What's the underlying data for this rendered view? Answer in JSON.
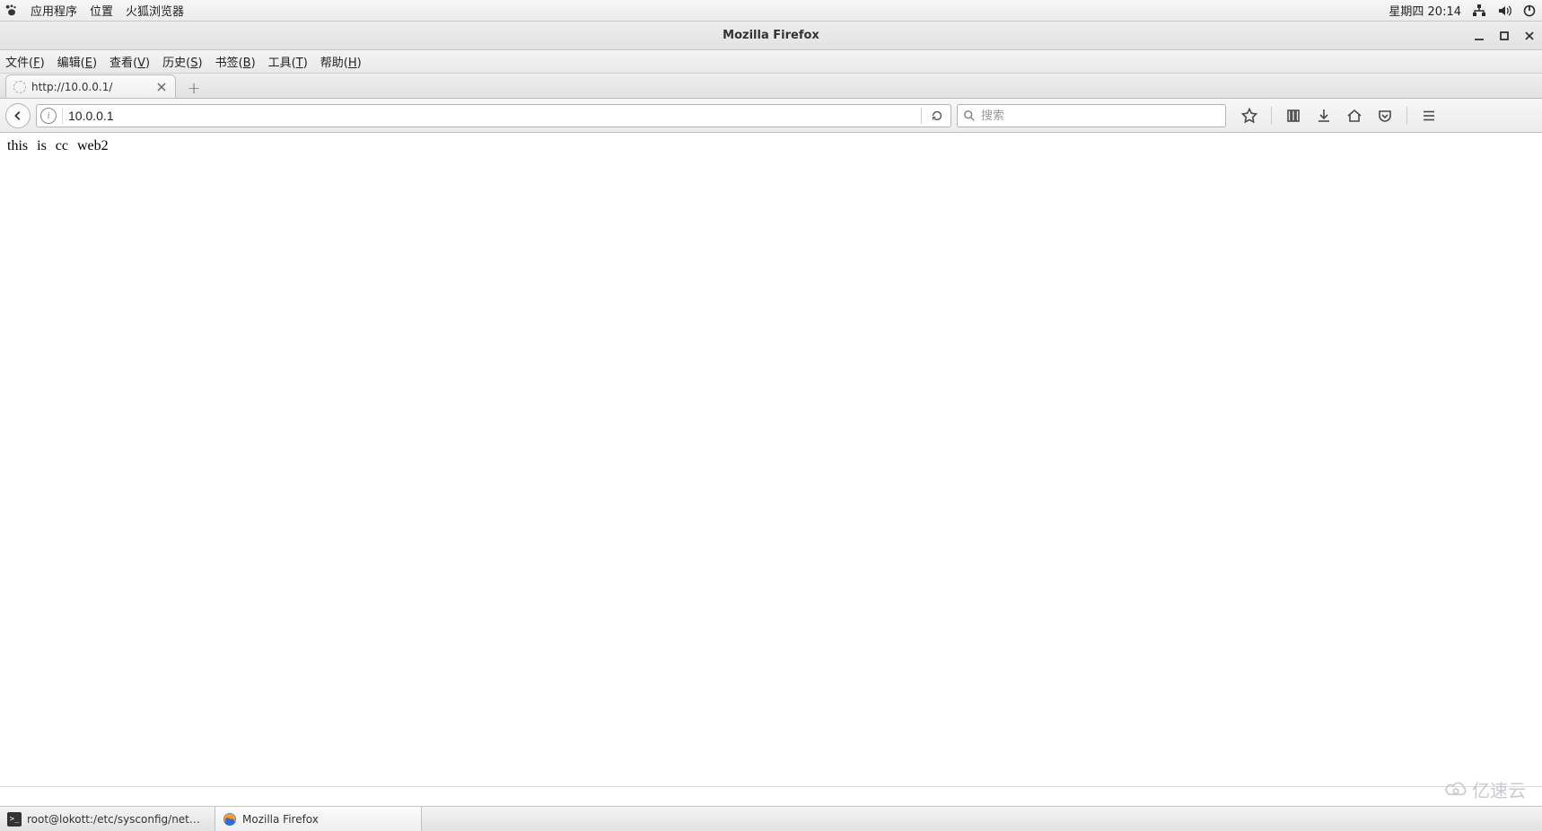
{
  "gnome": {
    "menus": {
      "applications": "应用程序",
      "places": "位置",
      "firefox": "火狐浏览器"
    },
    "clock": "星期四 20:14",
    "tray": {
      "network": "network-icon",
      "volume": "volume-icon",
      "power": "power-icon"
    }
  },
  "window": {
    "title": "Mozilla Firefox"
  },
  "menubar": {
    "file": {
      "label": "文件",
      "accel": "F"
    },
    "edit": {
      "label": "编辑",
      "accel": "E"
    },
    "view": {
      "label": "查看",
      "accel": "V"
    },
    "history": {
      "label": "历史",
      "accel": "S"
    },
    "bookmarks": {
      "label": "书签",
      "accel": "B"
    },
    "tools": {
      "label": "工具",
      "accel": "T"
    },
    "help": {
      "label": "帮助",
      "accel": "H"
    }
  },
  "tab": {
    "label": "http://10.0.0.1/"
  },
  "urlbar": {
    "value": "10.0.0.1"
  },
  "searchbar": {
    "placeholder": "搜索"
  },
  "page": {
    "body_text": "this is cc web2"
  },
  "taskbar": {
    "terminal": "root@lokott:/etc/sysconfig/networ…",
    "firefox": "Mozilla Firefox"
  },
  "watermark": {
    "text": "亿速云"
  }
}
